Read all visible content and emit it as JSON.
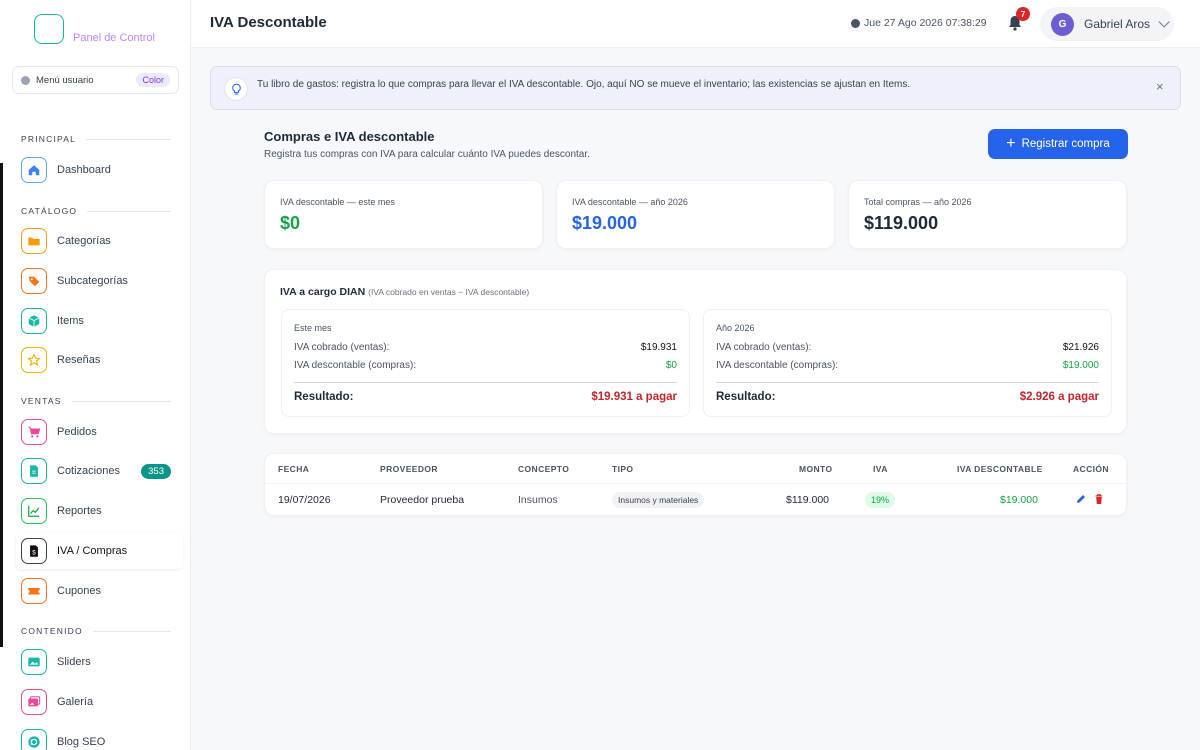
{
  "sidebar": {
    "brand": "Panel de Control",
    "user_menu": {
      "label": "Menú usuario",
      "tag": "Color"
    },
    "sections": {
      "principal": "PRINCIPAL",
      "catalogo": "CATÁLOGO",
      "ventas": "VENTAS",
      "contenido": "CONTENIDO"
    },
    "items": {
      "dashboard": "Dashboard",
      "categorias": "Categorías",
      "subcategorias": "Subcategorías",
      "items": "Items",
      "resenas": "Reseñas",
      "pedidos": "Pedidos",
      "cotizaciones": "Cotizaciones",
      "cotizaciones_badge": "353",
      "reportes": "Reportes",
      "iva": "IVA / Compras",
      "cupones": "Cupones",
      "sliders": "Sliders",
      "galeria": "Galería",
      "blog": "Blog SEO"
    }
  },
  "header": {
    "title": "IVA Descontable",
    "datetime": "Jue 27 Ago 2026 07:38:29",
    "notifications": "7",
    "user": {
      "initial": "G",
      "name": "Gabriel Aros"
    }
  },
  "alert": {
    "text": "Tu libro de gastos: registra lo que compras para llevar el IVA descontable. Ojo, aquí NO se mueve el inventario; las existencias se ajustan en Items.",
    "close": "×"
  },
  "section": {
    "title": "Compras e IVA descontable",
    "subtitle": "Registra tus compras con IVA para calcular cuánto IVA puedes descontar.",
    "button": "Registrar compra"
  },
  "stats": [
    {
      "label": "IVA descontable — este mes",
      "value": "$0"
    },
    {
      "label": "IVA descontable — año 2026",
      "value": "$19.000"
    },
    {
      "label": "Total compras — año 2026",
      "value": "$119.000"
    }
  ],
  "dian": {
    "title": "IVA a cargo DIAN",
    "note": "(IVA cobrado en ventas − IVA descontable)",
    "month": {
      "head": "Este mes",
      "cobrado_label": "IVA cobrado (ventas):",
      "cobrado": "$19.931",
      "descontable_label": "IVA descontable (compras):",
      "descontable": "$0",
      "result_label": "Resultado:",
      "result": "$19.931 a pagar"
    },
    "year": {
      "head": "Año 2026",
      "cobrado_label": "IVA cobrado (ventas):",
      "cobrado": "$21.926",
      "descontable_label": "IVA descontable (compras):",
      "descontable": "$19.000",
      "result_label": "Resultado:",
      "result": "$2.926 a pagar"
    }
  },
  "table": {
    "headers": {
      "fecha": "FECHA",
      "proveedor": "PROVEEDOR",
      "concepto": "CONCEPTO",
      "tipo": "TIPO",
      "monto": "MONTO",
      "iva": "IVA",
      "iva_desc": "IVA DESCONTABLE",
      "accion": "ACCIÓN"
    },
    "rows": [
      {
        "fecha": "19/07/2026",
        "proveedor": "Proveedor prueba",
        "concepto": "Insumos",
        "tipo": "Insumos y materiales",
        "monto": "$119.000",
        "iva": "19%",
        "iva_desc": "$19.000"
      }
    ]
  },
  "colors": {
    "primary": "#2563eb",
    "green": "#16a34a",
    "blue": "#2563eb",
    "red": "#c0262d"
  }
}
